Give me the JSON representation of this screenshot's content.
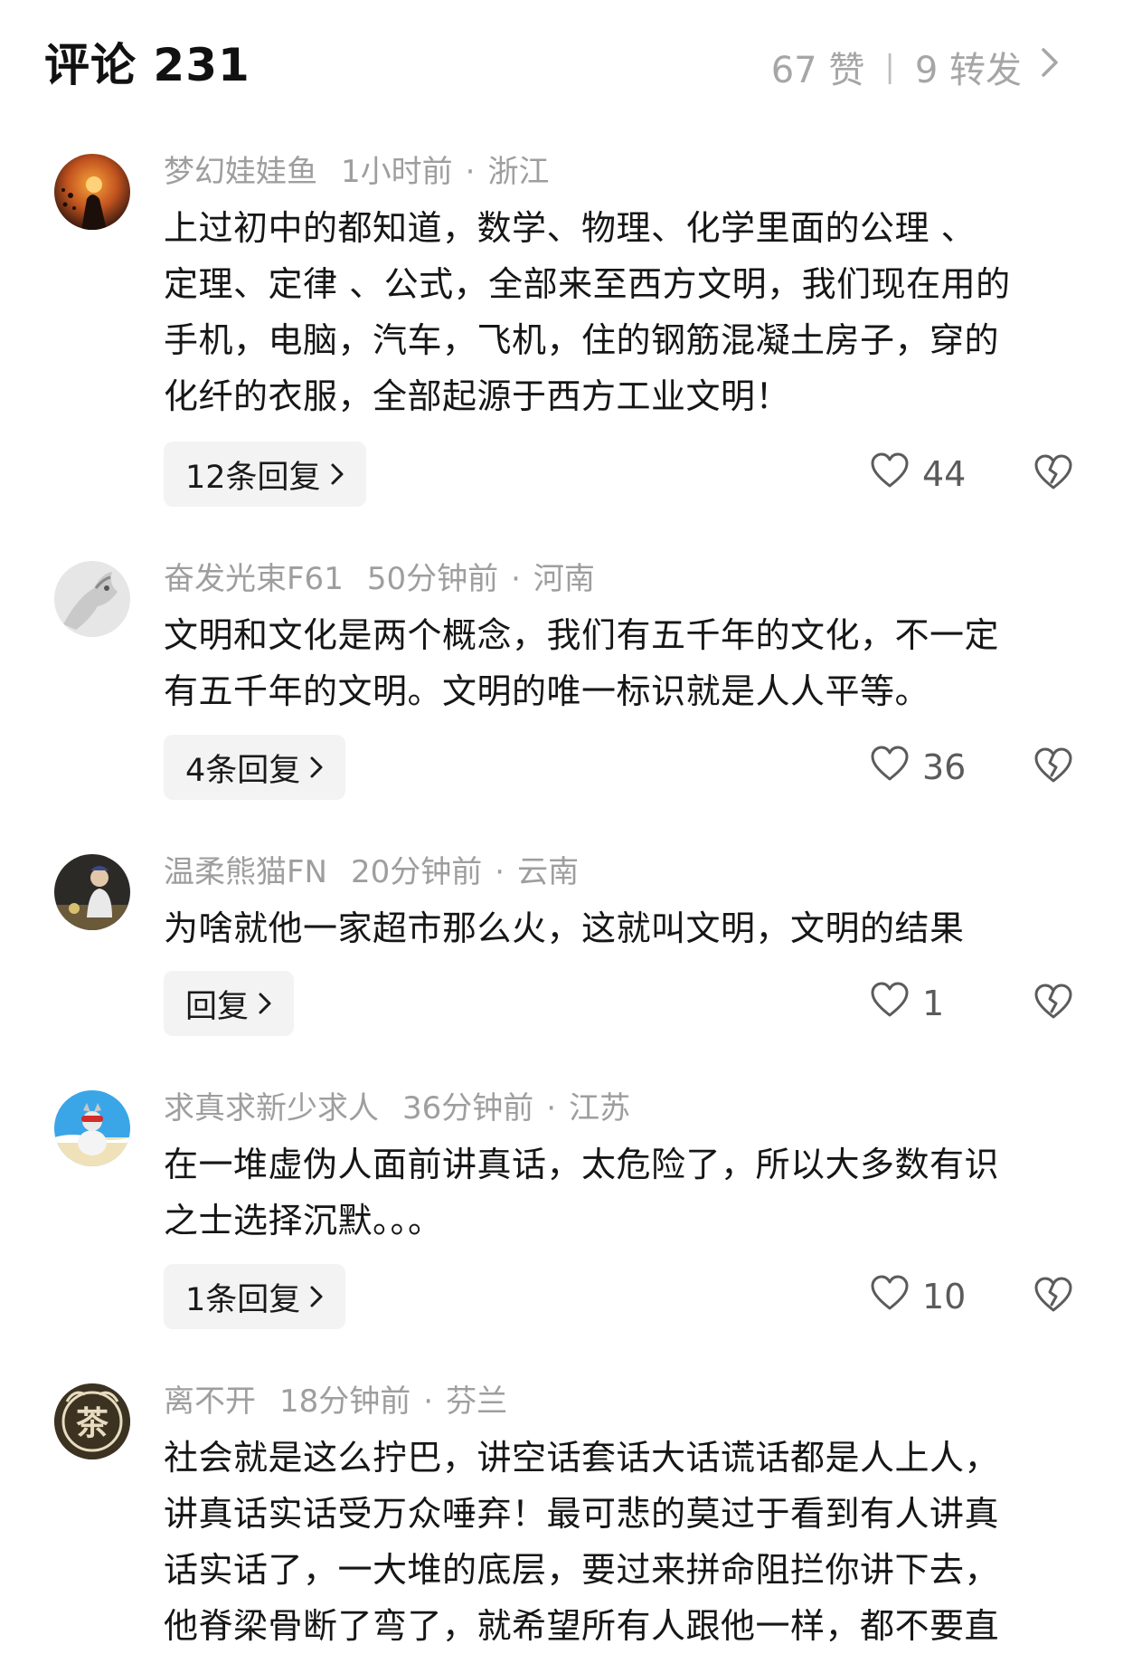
{
  "header": {
    "title": "评论 231",
    "likes": "67 赞",
    "separator": "|",
    "shares": "9 转发"
  },
  "comments": [
    {
      "user": "梦幻娃娃鱼",
      "time": "1小时前",
      "location": "浙江",
      "lines": [
        "上过初中的都知道，数学、物理、化学里面的公理 、",
        "定理、定律 、公式，全部来至西方文明，我们现在用的",
        "手机，电脑，汽车，飞机，住的钢筋混凝土房子，穿的",
        "化纤的衣服，全部起源于西方工业文明！"
      ],
      "reply": "12条回复",
      "likes": "44"
    },
    {
      "user": "奋发光束F61",
      "time": "50分钟前",
      "location": "河南",
      "lines": [
        "文明和文化是两个概念，我们有五千年的文化，不一定",
        "有五千年的文明。文明的唯一标识就是人人平等。"
      ],
      "reply": "4条回复",
      "likes": "36"
    },
    {
      "user": "温柔熊猫FN",
      "time": "20分钟前",
      "location": "云南",
      "lines": [
        "为啥就他一家超市那么火，这就叫文明，文明的结果"
      ],
      "reply": "回复",
      "likes": "1"
    },
    {
      "user": "求真求新少求人",
      "time": "36分钟前",
      "location": "江苏",
      "lines": [
        "在一堆虚伪人面前讲真话，太危险了，所以大多数有识",
        "之士选择沉默。。。"
      ],
      "reply": "1条回复",
      "likes": "10"
    },
    {
      "user": "离不开",
      "time": "18分钟前",
      "location": "芬兰",
      "lines": [
        "社会就是这么拧巴，讲空话套话大话谎话都是人上人，",
        "讲真话实话受万众唾弃！最可悲的莫过于看到有人讲真",
        "话实话了，一大堆的底层，要过来拼命阻拦你讲下去，",
        "他脊梁骨断了弯了，就希望所有人跟他一样，都不要直"
      ],
      "avatar_text": "茶"
    }
  ],
  "colors": {
    "meta_text": "#9e9e9e",
    "reply_bg": "#f3f3f3",
    "body_text": "#161616"
  },
  "icons": [
    "chevron-right-icon",
    "heart-outline-icon",
    "broken-heart-icon"
  ]
}
